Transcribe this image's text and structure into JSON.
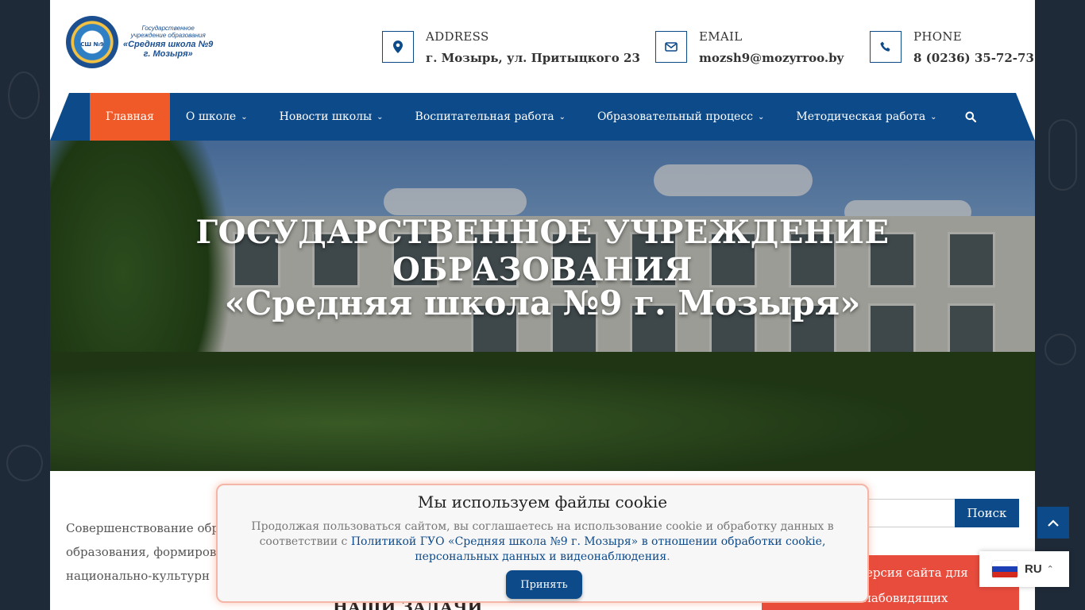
{
  "logo": {
    "line1": "Государственное",
    "line2": "учреждение образования",
    "line3": "«Средняя школа №9",
    "line4": "г. Мозыря»",
    "emblem_text": "СШ №9"
  },
  "contacts": {
    "address": {
      "label": "ADDRESS",
      "value": "г. Мозырь, ул. Притыцкого 23",
      "icon": "map-marker-icon"
    },
    "email": {
      "label": "EMAIL",
      "value": "mozsh9@mozyrroo.by",
      "icon": "envelope-icon"
    },
    "phone": {
      "label": "PHONE",
      "value": "8 (0236) 35-72-73",
      "icon": "phone-icon"
    }
  },
  "nav": {
    "items": [
      {
        "label": "Главная",
        "active": true
      },
      {
        "label": "О школе"
      },
      {
        "label": "Новости школы"
      },
      {
        "label": "Воспитательная работа"
      },
      {
        "label": "Образовательный процесс"
      },
      {
        "label": "Методическая работа"
      }
    ],
    "search_icon": "search-icon"
  },
  "hero": {
    "title_line1": "ГОСУДАРСТВЕННОЕ УЧРЕЖДЕНИЕ ОБРАЗОВАНИЯ",
    "title_line2": "«Средняя школа №9 г. Мозыря»"
  },
  "content": {
    "paragraph_lines": [
      "Совершенствование обр",
      "образования, формиров",
      "национально-культурн"
    ],
    "heading_partial": "НАШИ ЗАДАЧИ"
  },
  "sidebar": {
    "search_button": "Поиск",
    "red_box_lines": [
      "Версия сайта для",
      "слабовидящих"
    ]
  },
  "cookie": {
    "title": "Мы используем файлы cookie",
    "text_before": "Продолжая пользоваться сайтом, вы соглашаетесь на использование cookie и обработку данных в соответствии с ",
    "link_text": "Политикой ГУО «Средняя школа №9 г. Мозыря» в отношении обработки cookie, персональных данных и видеонаблюдения",
    "text_after": ".",
    "accept_button": "Принять"
  },
  "lang": {
    "code": "RU"
  },
  "colors": {
    "nav_bg": "#0d4a8a",
    "nav_active": "#f05a28",
    "accent_red": "#e84c3d",
    "background": "#1f2a38"
  }
}
